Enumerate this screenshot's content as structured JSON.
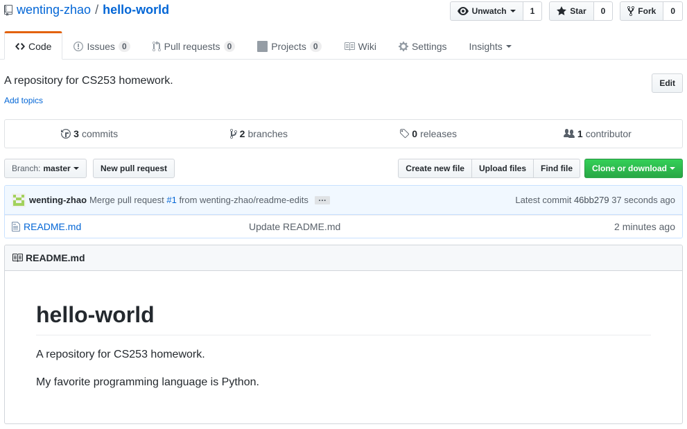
{
  "repo": {
    "owner": "wenting-zhao",
    "separator": "/",
    "name": "hello-world"
  },
  "actions": [
    {
      "label": "Unwatch",
      "count": "1"
    },
    {
      "label": "Star",
      "count": "0"
    },
    {
      "label": "Fork",
      "count": "0"
    }
  ],
  "nav": {
    "code": "Code",
    "issues": "Issues",
    "issues_count": "0",
    "pulls": "Pull requests",
    "pulls_count": "0",
    "projects": "Projects",
    "projects_count": "0",
    "wiki": "Wiki",
    "settings": "Settings",
    "insights": "Insights"
  },
  "description": "A repository for CS253 homework.",
  "add_topics": "Add topics",
  "edit_label": "Edit",
  "summary": {
    "commits_num": "3",
    "commits_label": "commits",
    "branches_num": "2",
    "branches_label": "branches",
    "releases_num": "0",
    "releases_label": "releases",
    "contributors_num": "1",
    "contributors_label": "contributor"
  },
  "branch": {
    "label": "Branch:",
    "value": "master"
  },
  "new_pr_label": "New pull request",
  "file_actions": {
    "create": "Create new file",
    "upload": "Upload files",
    "find": "Find file",
    "clone": "Clone or download"
  },
  "commit": {
    "author": "wenting-zhao",
    "msg_prefix": "Merge pull request",
    "pr": "#1",
    "msg_suffix": "from wenting-zhao/readme-edits",
    "ellipsis": "…",
    "latest_label": "Latest commit",
    "sha": "46bb279",
    "time": "37 seconds ago"
  },
  "files": [
    {
      "name": "README.md",
      "message": "Update README.md",
      "age": "2 minutes ago"
    }
  ],
  "readme": {
    "header": "README.md",
    "title": "hello-world",
    "paragraphs": [
      "A repository for CS253 homework.",
      "My favorite programming language is Python."
    ]
  },
  "colors": {
    "accent": "#e36209",
    "link": "#0366d6",
    "primary": "#28a745"
  },
  "icons": [
    "repo-icon",
    "eye-icon",
    "star-icon",
    "fork-icon",
    "code-icon",
    "issue-icon",
    "pull-request-icon",
    "project-icon",
    "book-icon",
    "gear-icon",
    "history-icon",
    "branch-icon",
    "tag-icon",
    "people-icon",
    "file-icon",
    "avatar-identicon"
  ]
}
